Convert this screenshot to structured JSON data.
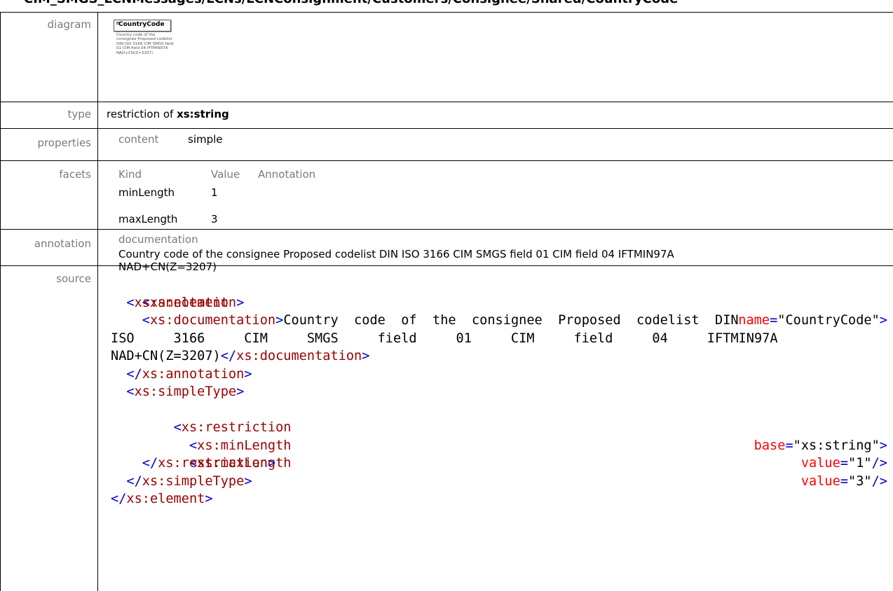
{
  "page": {
    "title": "CIM_SMGS_LCNMessages/LCNs/LCNConsignment/Customers/Consignee/Shared/CountryCode"
  },
  "labels": {
    "diagram": "diagram",
    "type": "type",
    "properties": "properties",
    "facets": "facets",
    "annotation": "annotation",
    "source": "source"
  },
  "diagram": {
    "element_name": "CountryCode",
    "doc_text": "Country code of the consignee Proposed codelist DIN ISO 3166 CIM SMGS field 01 CIM field 04 IFTMIN97A NAD+CN(Z=3207)"
  },
  "type": {
    "prefix": "restriction of ",
    "base": "xs:string"
  },
  "properties": {
    "key": "content",
    "value": "simple"
  },
  "facets": {
    "headers": [
      "Kind",
      "Value",
      "Annotation"
    ],
    "rows": [
      {
        "kind": "minLength",
        "value": "1"
      },
      {
        "kind": "maxLength",
        "value": "3"
      }
    ]
  },
  "annotation": {
    "heading": "documentation",
    "line1": "Country code of the consignee Proposed codelist DIN ISO 3166 CIM SMGS field 01 CIM field 04 IFTMIN97A",
    "line2": "NAD+CN(Z=3207)"
  },
  "source": {
    "l1_tag": "xs:element",
    "l1_attr": "name",
    "l1_val": "\"CountryCode\"",
    "l2_tag": "xs:annotation",
    "l3_tag": "xs:documentation",
    "l3_text": "Country  code  of  the  consignee  Proposed  codelist  DIN",
    "l4_text": "ISO     3166     CIM     SMGS     field     01     CIM     field     04     IFTMIN97A",
    "l5_text": "NAD+CN(Z=3207)",
    "l5_close": "xs:documentation",
    "l6_close": "xs:annotation",
    "l7_tag": "xs:simpleType",
    "l8_tag": "xs:restriction",
    "l8_attr": "base",
    "l8_val": "\"xs:string\"",
    "l9_tag": "xs:minLength",
    "l9_attr": "value",
    "l9_val": "\"1\"",
    "l10_tag": "xs:maxLength",
    "l10_attr": "value",
    "l10_val": "\"3\"",
    "l11_close": "xs:restriction",
    "l12_close": "xs:simpleType",
    "l13_close": "xs:element"
  }
}
